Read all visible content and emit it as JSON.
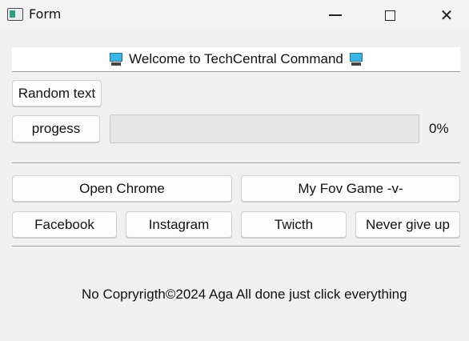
{
  "window": {
    "title": "Form",
    "icons": {
      "app": "form-window-icon",
      "minimize": "minimize-icon",
      "maximize": "maximize-icon",
      "close": "close-icon"
    }
  },
  "welcome": {
    "text": "Welcome to TechCentral Command",
    "icon": "computer-icon"
  },
  "buttons": {
    "random_text": "Random text",
    "progress": "progess",
    "open_chrome": "Open Chrome",
    "my_fov_game": "My Fov Game -v-",
    "facebook": "Facebook",
    "instagram": "Instagram",
    "twitch": "Twicth",
    "never_give_up": "Never give up"
  },
  "progress": {
    "value": 0,
    "text": "0%",
    "fill_color": "#06b025"
  },
  "footer": {
    "text": "No Copryrigth©2024 Aga All done just click everything"
  }
}
